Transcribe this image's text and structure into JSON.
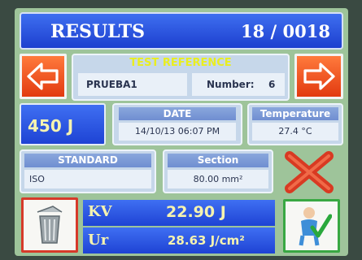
{
  "header": {
    "title": "RESULTS",
    "counter": "18 / 0018"
  },
  "test_reference": {
    "label": "TEST REFERENCE",
    "value": "PRUEBA1",
    "number_label": "Number:",
    "number_value": "6"
  },
  "energy": "450 J",
  "date": {
    "label": "DATE",
    "value": "14/10/13 06:07 PM"
  },
  "temperature": {
    "label": "Temperature",
    "value": "27.4 °C"
  },
  "standard": {
    "label": "STANDARD",
    "value": "ISO"
  },
  "section": {
    "label": "Section",
    "value": "80.00 mm²"
  },
  "kv": {
    "label": "KV",
    "value": "22.90 J"
  },
  "ur": {
    "label": "Ur",
    "value": "28.63 J/cm²"
  },
  "icons": {
    "prev": "arrow-left-icon",
    "next": "arrow-right-icon",
    "delete": "red-x-icon",
    "trash": "trash-can-icon",
    "approve": "check-figure-icon"
  },
  "colors": {
    "accent_blue": "#2a52e0",
    "arrow_orange": "#f0521c",
    "label_yellow": "#f6f3b0"
  }
}
